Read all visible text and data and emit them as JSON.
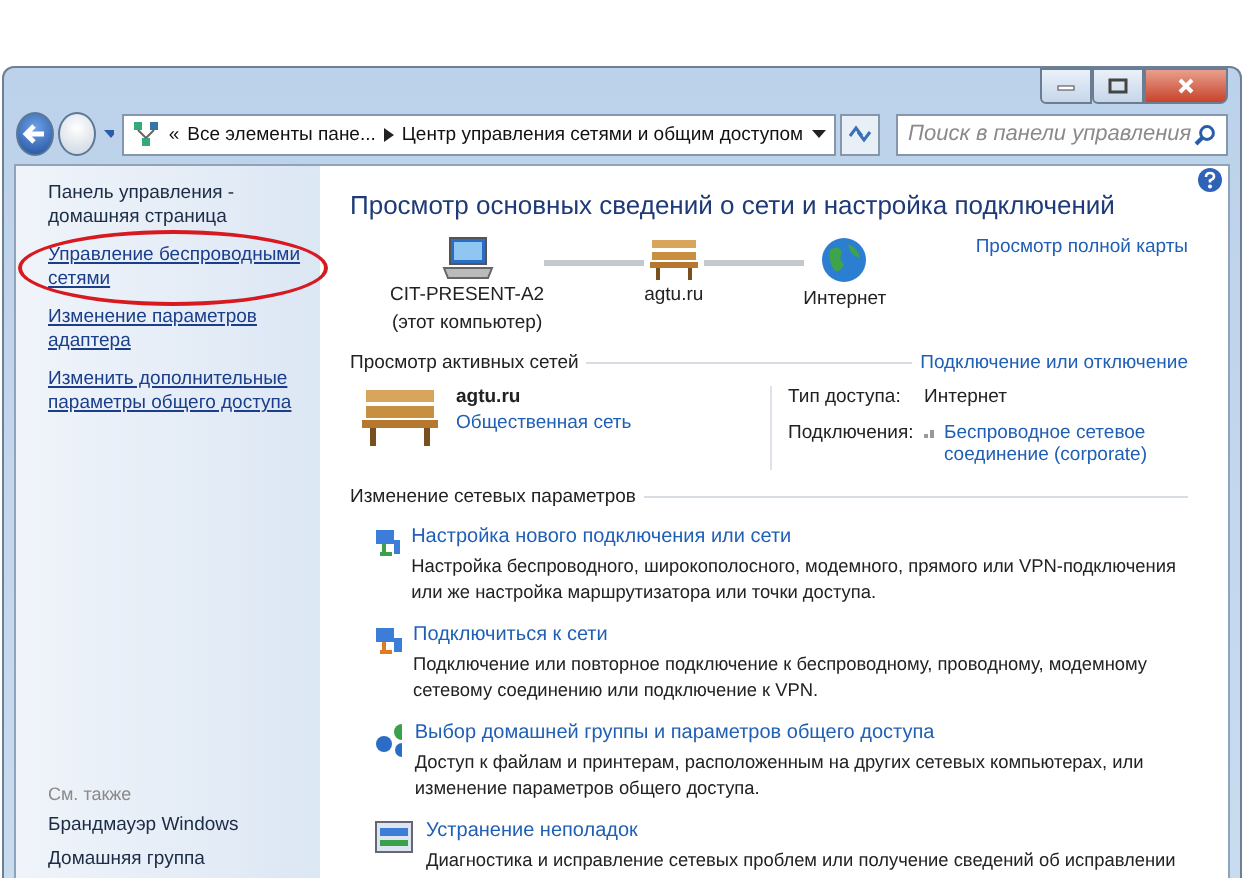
{
  "address_bar": {
    "overflow": "«",
    "segments": [
      "Все элементы пане...",
      "Центр управления сетями и общим доступом"
    ]
  },
  "search": {
    "placeholder": "Поиск в панели управления"
  },
  "sidebar": {
    "items": [
      {
        "text": "Панель управления - домашняя страница",
        "kind": "home",
        "circled": false
      },
      {
        "text": "Управление беспроводными сетями",
        "kind": "link",
        "circled": true
      },
      {
        "text": "Изменение параметров адаптера",
        "kind": "link",
        "circled": false
      },
      {
        "text": "Изменить дополнительные параметры общего доступа",
        "kind": "link",
        "circled": false
      }
    ],
    "see_also": {
      "title": "См. также",
      "items": [
        "Брандмауэр Windows",
        "Домашняя группа"
      ]
    }
  },
  "main": {
    "title": "Просмотр основных сведений о сети и настройка подключений",
    "map": {
      "nodes": [
        {
          "kind": "computer",
          "label": "CIT-PRESENT-A2",
          "sublabel": "(этот компьютер)"
        },
        {
          "kind": "network",
          "label": "agtu.ru"
        },
        {
          "kind": "internet",
          "label": "Интернет"
        }
      ],
      "full_map_link": "Просмотр полной карты"
    },
    "active_networks": {
      "heading": "Просмотр активных сетей",
      "link": "Подключение или отключение",
      "network": {
        "name": "agtu.ru",
        "type": "Общественная сеть"
      },
      "access_type_label": "Тип доступа:",
      "access_type": "Интернет",
      "connections_label": "Подключения:",
      "connection": "Беспроводное сетевое соединение (corporate)"
    },
    "change_settings": {
      "heading": "Изменение сетевых параметров",
      "tasks": [
        {
          "kind": "setup",
          "title": "Настройка нового подключения или сети",
          "description": "Настройка беспроводного, широкополосного, модемного, прямого или VPN-подключения или же настройка маршрутизатора или точки доступа."
        },
        {
          "kind": "connect",
          "title": "Подключиться к сети",
          "description": "Подключение или повторное подключение к беспроводному, проводному, модемному сетевому соединению или подключение к VPN."
        },
        {
          "kind": "homegroup",
          "title": "Выбор домашней группы и параметров общего доступа",
          "description": "Доступ к файлам и принтерам, расположенным на других сетевых компьютерах, или изменение параметров общего доступа."
        },
        {
          "kind": "troubleshoot",
          "title": "Устранение неполадок",
          "description": "Диагностика и исправление сетевых проблем или получение сведений об исправлении"
        }
      ]
    }
  }
}
